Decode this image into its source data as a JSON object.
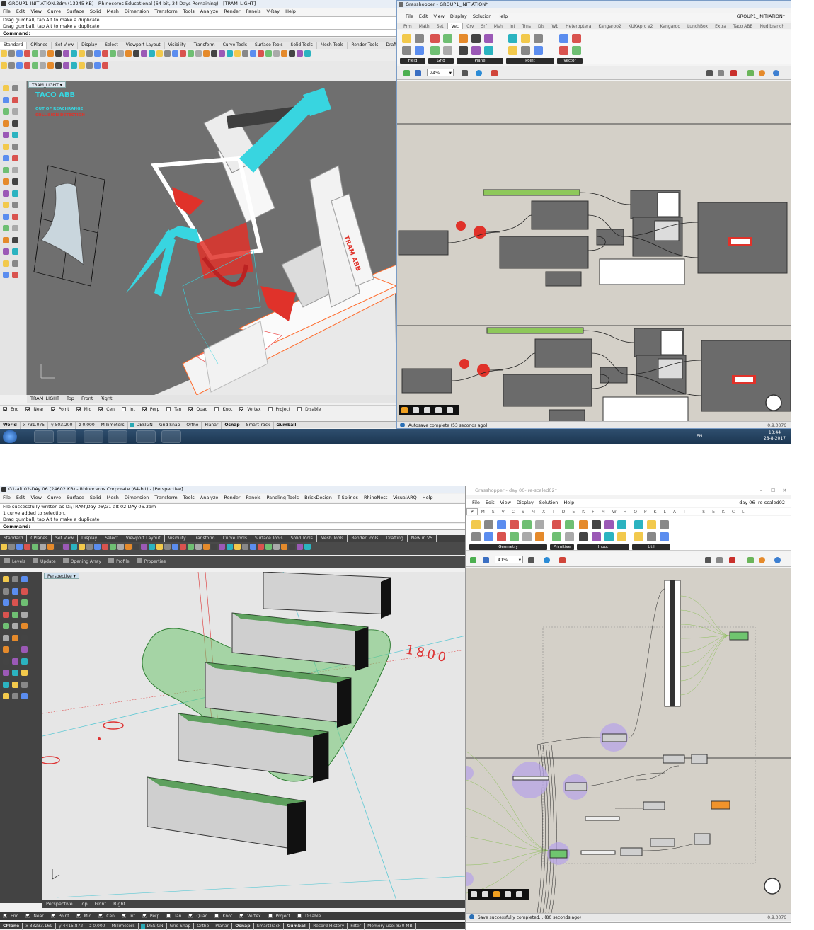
{
  "screen1": {
    "rhino": {
      "title": "GROUP1_INITIATION.3dm (13245 KB) - Rhinoceros Educational (64-bit, 34 Days Remaining) - [TRAM_LIGHT]",
      "menu": [
        "File",
        "Edit",
        "View",
        "Curve",
        "Surface",
        "Solid",
        "Mesh",
        "Dimension",
        "Transform",
        "Tools",
        "Analyze",
        "Render",
        "Panels",
        "V-Ray",
        "Help"
      ],
      "history": [
        "Drag gumball, tap Alt to make a duplicate",
        "Drag gumball, tap Alt to make a duplicate"
      ],
      "command_label": "Command:",
      "toolbar_tabs": [
        "Standard",
        "CPlanes",
        "Set View",
        "Display",
        "Select",
        "Viewport Layout",
        "Visibility",
        "Transform",
        "Curve Tools",
        "Surface Tools",
        "Solid Tools",
        "Mesh Tools",
        "Render Tools",
        "Drafting"
      ],
      "viewport_tab": "TRAM_LIGHT",
      "overlay": {
        "title": "TACO ABB",
        "line1": "OUT OF REACHRANGE",
        "line2": "COLLISION DETECTION"
      },
      "robot_label": "TRAM ABB",
      "view_tabs": [
        "TRAM_LIGHT",
        "Top",
        "Front",
        "Right"
      ],
      "osnap": [
        {
          "label": "End",
          "on": true
        },
        {
          "label": "Near",
          "on": true
        },
        {
          "label": "Point",
          "on": true
        },
        {
          "label": "Mid",
          "on": true
        },
        {
          "label": "Cen",
          "on": true
        },
        {
          "label": "Int",
          "on": false
        },
        {
          "label": "Perp",
          "on": true
        },
        {
          "label": "Tan",
          "on": false
        },
        {
          "label": "Quad",
          "on": true
        },
        {
          "label": "Knot",
          "on": false
        },
        {
          "label": "Vertex",
          "on": true
        },
        {
          "label": "Project",
          "on": false
        },
        {
          "label": "Disable",
          "on": false
        }
      ],
      "status": {
        "cplane": "World",
        "x": "x 731.075",
        "y": "y 503.200",
        "z": "z 0.000",
        "units": "Millimeters",
        "layer": "DESIGN",
        "toggles": [
          "Grid Snap",
          "Ortho",
          "Planar",
          "Osnap",
          "SmartTrack",
          "Gumball"
        ],
        "bold_toggles": [
          "Osnap",
          "Gumball"
        ]
      }
    },
    "gh": {
      "title": "Grasshopper - GROUP1_INITIATION*",
      "doc_name": "GROUP1_INITIATION*",
      "menu": [
        "File",
        "Edit",
        "View",
        "Display",
        "Solution",
        "Help"
      ],
      "tabs": [
        "Prm",
        "Math",
        "Set",
        "Vec",
        "Crv",
        "Srf",
        "Msh",
        "Int",
        "Trns",
        "Dis",
        "Wb",
        "Heteroptera",
        "Kangaroo2",
        "KUKAprc v2",
        "Kangaroo",
        "LunchBox",
        "Extra",
        "Taco ABB",
        "Nudibranch"
      ],
      "active_tab": "Vec",
      "groups": [
        "Field",
        "Grid",
        "Plane",
        "Point",
        "Vector"
      ],
      "zoom": "24%",
      "status": "Autosave complete (53 seconds ago)",
      "version": "0.9.0076"
    },
    "taskbar": {
      "lang": "EN",
      "time": "13:44",
      "date": "28-8-2017"
    }
  },
  "screen2": {
    "rhino": {
      "title": "G1-alt 02-DAy 06 (24602 KB) - Rhinoceros Corporate (64-bit) - [Perspective]",
      "menu": [
        "File",
        "Edit",
        "View",
        "Curve",
        "Surface",
        "Solid",
        "Mesh",
        "Dimension",
        "Transform",
        "Tools",
        "Analyze",
        "Render",
        "Panels",
        "Paneling Tools",
        "BrickDesign",
        "T-Splines",
        "RhinoNest",
        "VisualARQ",
        "Help"
      ],
      "history": [
        "File successfully written as D:\\TRAM\\Day 06\\G1-alt 02-DAy 06.3dm",
        "1 curve added to selection.",
        "Drag gumball, tap Alt to make a duplicate"
      ],
      "command_label": "Command:",
      "toolbar_tabs": [
        "Standard",
        "CPlanes",
        "Set View",
        "Display",
        "Select",
        "Viewport Layout",
        "Visibility",
        "Transform",
        "Curve Tools",
        "Surface Tools",
        "Solid Tools",
        "Mesh Tools",
        "Render Tools",
        "Drafting",
        "New in V5"
      ],
      "extra_bar": [
        "Levels",
        "Update",
        "Opening Array",
        "Profile",
        "Properties"
      ],
      "viewport_tab": "Perspective",
      "dim_text": "1800",
      "view_tabs": [
        "Perspective",
        "Top",
        "Front",
        "Right"
      ],
      "osnap": [
        {
          "label": "End",
          "on": true
        },
        {
          "label": "Near",
          "on": true
        },
        {
          "label": "Point",
          "on": true
        },
        {
          "label": "Mid",
          "on": true
        },
        {
          "label": "Cen",
          "on": true
        },
        {
          "label": "Int",
          "on": true
        },
        {
          "label": "Perp",
          "on": true
        },
        {
          "label": "Tan",
          "on": false
        },
        {
          "label": "Quad",
          "on": true
        },
        {
          "label": "Knot",
          "on": false
        },
        {
          "label": "Vertex",
          "on": true
        },
        {
          "label": "Project",
          "on": false
        },
        {
          "label": "Disable",
          "on": false
        }
      ],
      "status": {
        "cplane": "CPlane",
        "x": "x 33233.169",
        "y": "y 4415.872",
        "z": "z 0.000",
        "units": "Millimeters",
        "layer": "DESIGN",
        "toggles": [
          "Grid Snap",
          "Ortho",
          "Planar",
          "Osnap",
          "SmartTrack",
          "Gumball",
          "Record History",
          "Filter",
          "Memory use: 830 MB"
        ],
        "bold_toggles": [
          "Osnap",
          "Gumball"
        ]
      }
    },
    "gh": {
      "title": "Grasshopper - day 06- re-scaled02*",
      "doc_name": "day 06- re-scaled02",
      "menu": [
        "File",
        "Edit",
        "View",
        "Display",
        "Solution",
        "Help"
      ],
      "tabs": [
        "P",
        "M",
        "S",
        "V",
        "C",
        "S",
        "M",
        "X",
        "T",
        "D",
        "E",
        "K",
        "F",
        "M",
        "W",
        "H",
        "Q",
        "P",
        "K",
        "L",
        "A",
        "T",
        "T",
        "S",
        "E",
        "K",
        "C",
        "L"
      ],
      "groups": [
        "Geometry",
        "Primitive",
        "Input",
        "Util"
      ],
      "zoom": "41%",
      "status": "Save successfully completed... (80 seconds ago)",
      "version": "0.9.0076"
    }
  },
  "colors": {
    "gh_canvas": "#d4d0c8",
    "rhino_vp1": "#6f6f6f",
    "rhino_vp2": "#e6e6e6",
    "cyan": "#38d5e0",
    "robot_red": "#e0322a",
    "green_ribbon": "#6fc56f",
    "purple_bubble": "#b7a3e8"
  }
}
